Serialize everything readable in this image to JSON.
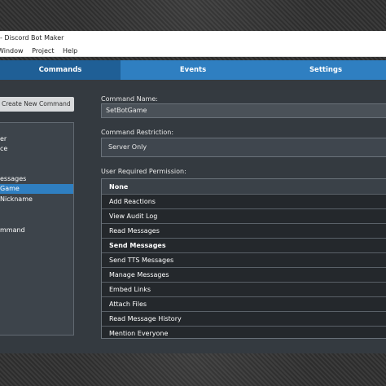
{
  "window": {
    "title": "- Discord Bot Maker"
  },
  "menu": {
    "items": [
      "Window",
      "Project",
      "Help"
    ]
  },
  "tabs": {
    "commands": "Commands",
    "events": "Events",
    "settings": "Settings"
  },
  "sidebar": {
    "create_button": "Create New Command",
    "commands": [
      "er",
      "ce",
      "essages",
      "Game",
      "Nickname",
      "mmand"
    ],
    "selected_index": 3
  },
  "form": {
    "command_name_label": "Command Name:",
    "command_name_value": "SetBotGame",
    "restriction_label": "Command Restriction:",
    "restriction_value": "Server Only",
    "permission_label": "User Required Permission:",
    "permissions": [
      "None",
      "Add Reactions",
      "View Audit Log",
      "Read Messages",
      "Send Messages",
      "Send TTS Messages",
      "Manage Messages",
      "Embed Links",
      "Attach Files",
      "Read Message History",
      "Mention Everyone"
    ]
  },
  "colors": {
    "active_tab": "#1f5f96",
    "tab": "#2f7fc1",
    "panel": "#343a40",
    "selection": "#2f7fc1"
  }
}
